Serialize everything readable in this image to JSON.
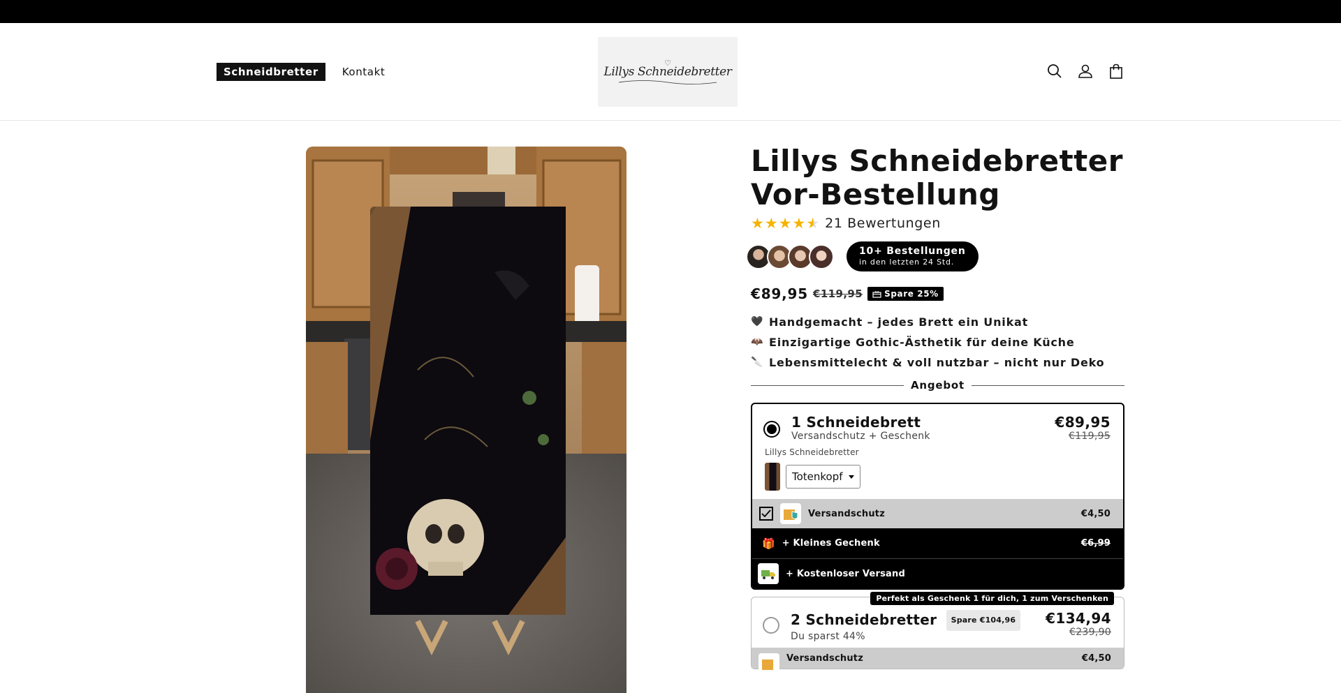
{
  "header": {
    "nav": [
      {
        "label": "Schneidbretter",
        "active": true
      },
      {
        "label": "Kontakt",
        "active": false
      }
    ],
    "logo_text": "Lillys Schneidebretter",
    "icons": [
      "search-icon",
      "account-icon",
      "cart-icon"
    ]
  },
  "product": {
    "title_line1": "Lillys Schneidebretter",
    "title_line2": "Vor-Bestellung",
    "rating": 4.5,
    "reviews_text": "21 Bewertungen",
    "orders_main": "10+ Bestellungen",
    "orders_sub": "in den letzten 24 Std.",
    "price": "€89,95",
    "price_old": "€119,95",
    "save_badge": "Spare 25%",
    "bullets": [
      {
        "emoji": "🖤",
        "text": "Handgemacht – jedes Brett ein Unikat"
      },
      {
        "emoji": "🦇",
        "text": "Einzigartige Gothic-Ästhetik für deine Küche"
      },
      {
        "emoji": "🔪",
        "text": "Lebensmittelecht & voll nutzbar – nicht nur Deko"
      }
    ],
    "offer_label": "Angebot"
  },
  "offers": [
    {
      "title": "1 Schneidebrett",
      "subtitle": "Versandschutz + Geschenk",
      "price": "€89,95",
      "price_old": "€119,95",
      "selected": true,
      "variant_label": "Lillys Schneidebretter",
      "variant_value": "Totenkopf",
      "addons": [
        {
          "name": "Versandschutz",
          "price": "€4,50",
          "checked": true
        },
        {
          "name": "+ Kleines Gechenk",
          "price": "€6,99"
        },
        {
          "name": "+ Kostenloser Versand",
          "price": ""
        }
      ]
    },
    {
      "title": "2 Schneidebretter",
      "spare": "Spare €104,96",
      "subtitle": "Du sparst 44%",
      "price": "€134,94",
      "price_old": "€239,90",
      "selected": false,
      "tag": "Perfekt als Geschenk 1 für dich, 1 zum Verschenken",
      "addons": [
        {
          "name": "Versandschutz",
          "price": "€4,50"
        }
      ]
    }
  ],
  "colors": {
    "accent": "#000000",
    "star": "#f5b400",
    "addon_gray": "#cccccc"
  }
}
